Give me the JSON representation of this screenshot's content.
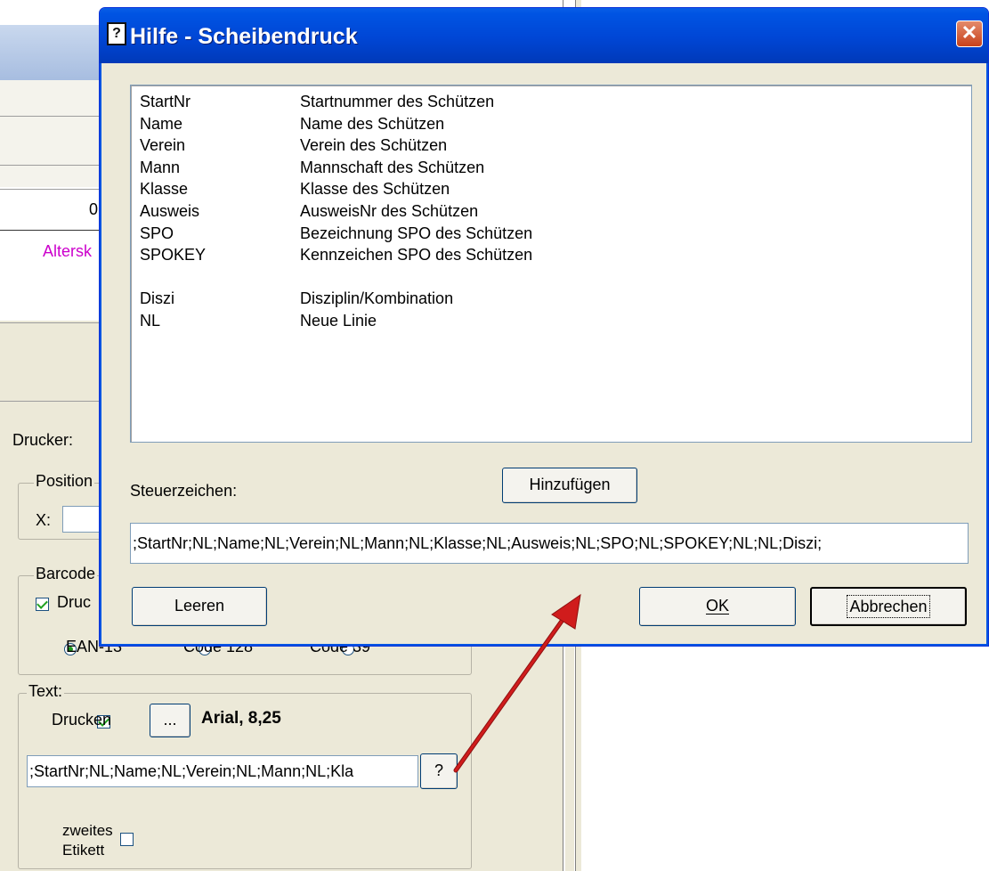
{
  "background": {
    "number_fragment": "0",
    "alters_fragment": "Altersk",
    "drucker_label": "Drucker:",
    "position_group": {
      "label": "Position",
      "x_label": "X:"
    },
    "barcode_group": {
      "label": "Barcode",
      "print_label": "Druc",
      "print_checked": true,
      "radio_ean": "EAN-13",
      "radio_code128": "Code 128",
      "radio_code39": "Code 39"
    },
    "text_group": {
      "label": "Text:",
      "print_label": "Drucken",
      "print_checked": true,
      "font_button": "...",
      "font_info": "Arial, 8,25",
      "text_value": ";StartNr;NL;Name;NL;Verein;NL;Mann;NL;Kla",
      "help_button": "?"
    },
    "second_label": {
      "line1": "zweites",
      "line2": "Etikett",
      "checked": false
    }
  },
  "dialog": {
    "title": "Hilfe - Scheibendruck",
    "close_glyph": "✕",
    "help_items": [
      {
        "code": "StartNr",
        "desc": "Startnummer des Schützen"
      },
      {
        "code": "Name",
        "desc": "Name des Schützen"
      },
      {
        "code": "Verein",
        "desc": "Verein des Schützen"
      },
      {
        "code": "Mann",
        "desc": "Mannschaft des Schützen"
      },
      {
        "code": "Klasse",
        "desc": "Klasse des Schützen"
      },
      {
        "code": "Ausweis",
        "desc": "AusweisNr des Schützen"
      },
      {
        "code": "SPO",
        "desc": "Bezeichnung SPO des Schützen"
      },
      {
        "code": "SPOKEY",
        "desc": "Kennzeichen SPO des Schützen"
      },
      {
        "code": "Diszi",
        "desc": "Disziplin/Kombination"
      },
      {
        "code": "NL",
        "desc": "Neue Linie"
      }
    ],
    "steuerzeichen_label": "Steuerzeichen:",
    "add_button": "Hinzufügen",
    "steuerzeichen_value": ";StartNr;NL;Name;NL;Verein;NL;Mann;NL;Klasse;NL;Ausweis;NL;SPO;NL;SPOKEY;NL;NL;Diszi;",
    "clear_button": "Leeren",
    "ok_button": "OK",
    "cancel_button": "Abbrechen"
  },
  "colors": {
    "title_bar": "#0054e3",
    "alters_text": "#cc00cc",
    "arrow": "#cc1111"
  }
}
